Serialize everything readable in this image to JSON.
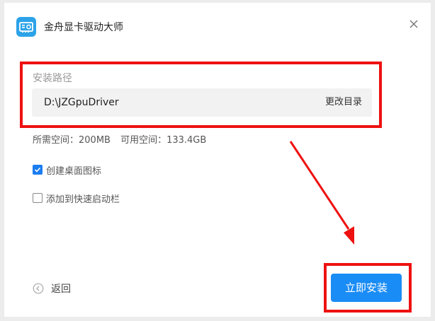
{
  "app": {
    "title": "金舟显卡驱动大师",
    "logo_icon": "gpu-card-icon",
    "logo_color": "#2ca3e9"
  },
  "install_path": {
    "label": "安装路径",
    "value": "D:\\JZGpuDriver",
    "change_label": "更改目录"
  },
  "space": {
    "required": "所需空间：200MB",
    "available": "可用空间：133.4GB"
  },
  "options": [
    {
      "label": "创建桌面图标",
      "checked": true
    },
    {
      "label": "添加到快速启动栏",
      "checked": false
    }
  ],
  "footer": {
    "back_label": "返回",
    "install_label": "立即安装"
  },
  "colors": {
    "accent": "#1a8cf5",
    "annotation": "#ee1111",
    "checkbox": "#1a7df0"
  }
}
